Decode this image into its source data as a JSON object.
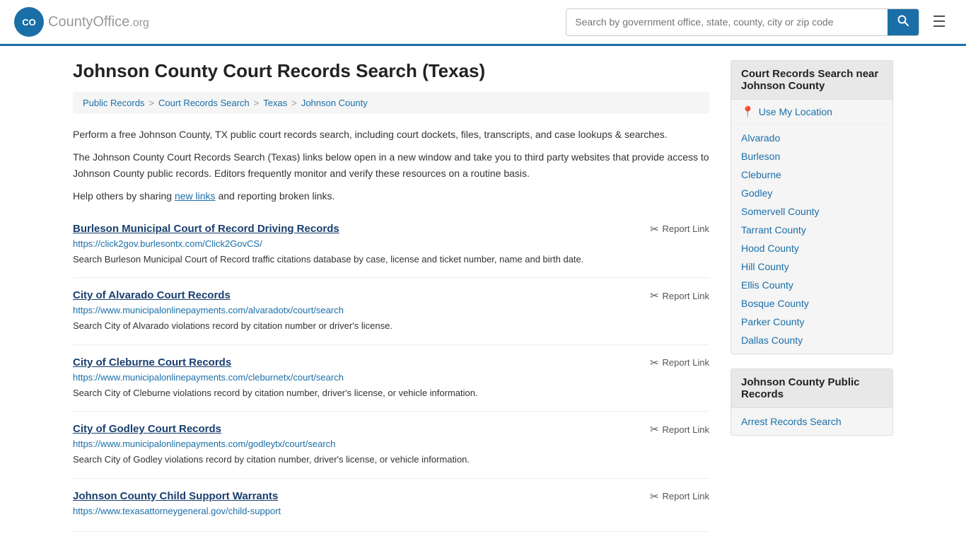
{
  "header": {
    "logo_text": "CountyOffice",
    "logo_suffix": ".org",
    "search_placeholder": "Search by government office, state, county, city or zip code",
    "hamburger_label": "☰"
  },
  "page": {
    "title": "Johnson County Court Records Search (Texas)",
    "breadcrumbs": [
      {
        "label": "Public Records",
        "href": "#"
      },
      {
        "label": "Court Records Search",
        "href": "#"
      },
      {
        "label": "Texas",
        "href": "#"
      },
      {
        "label": "Johnson County",
        "href": "#"
      }
    ],
    "description1": "Perform a free Johnson County, TX public court records search, including court dockets, files, transcripts, and case lookups & searches.",
    "description2": "The Johnson County Court Records Search (Texas) links below open in a new window and take you to third party websites that provide access to Johnson County public records. Editors frequently monitor and verify these resources on a routine basis.",
    "description3_prefix": "Help others by sharing ",
    "new_links_text": "new links",
    "description3_suffix": " and reporting broken links."
  },
  "records": [
    {
      "title": "Burleson Municipal Court of Record Driving Records",
      "url": "https://click2gov.burlesontx.com/Click2GovCS/",
      "desc": "Search Burleson Municipal Court of Record traffic citations database by case, license and ticket number, name and birth date.",
      "report_label": "Report Link"
    },
    {
      "title": "City of Alvarado Court Records",
      "url": "https://www.municipalonlinepayments.com/alvaradotx/court/search",
      "desc": "Search City of Alvarado violations record by citation number or driver's license.",
      "report_label": "Report Link"
    },
    {
      "title": "City of Cleburne Court Records",
      "url": "https://www.municipalonlinepayments.com/cleburnetx/court/search",
      "desc": "Search City of Cleburne violations record by citation number, driver's license, or vehicle information.",
      "report_label": "Report Link"
    },
    {
      "title": "City of Godley Court Records",
      "url": "https://www.municipalonlinepayments.com/godleytx/court/search",
      "desc": "Search City of Godley violations record by citation number, driver's license, or vehicle information.",
      "report_label": "Report Link"
    },
    {
      "title": "Johnson County Child Support Warrants",
      "url": "https://www.texasattorneygeneral.gov/child-support",
      "desc": "",
      "report_label": "Report Link"
    }
  ],
  "sidebar": {
    "section1_title": "Court Records Search near Johnson County",
    "use_location_label": "Use My Location",
    "nearby_items": [
      {
        "label": "Alvarado",
        "href": "#"
      },
      {
        "label": "Burleson",
        "href": "#"
      },
      {
        "label": "Cleburne",
        "href": "#"
      },
      {
        "label": "Godley",
        "href": "#"
      },
      {
        "label": "Somervell County",
        "href": "#"
      },
      {
        "label": "Tarrant County",
        "href": "#"
      },
      {
        "label": "Hood County",
        "href": "#"
      },
      {
        "label": "Hill County",
        "href": "#"
      },
      {
        "label": "Ellis County",
        "href": "#"
      },
      {
        "label": "Bosque County",
        "href": "#"
      },
      {
        "label": "Parker County",
        "href": "#"
      },
      {
        "label": "Dallas County",
        "href": "#"
      }
    ],
    "section2_title": "Johnson County Public Records",
    "public_records_items": [
      {
        "label": "Arrest Records Search",
        "href": "#"
      }
    ]
  }
}
